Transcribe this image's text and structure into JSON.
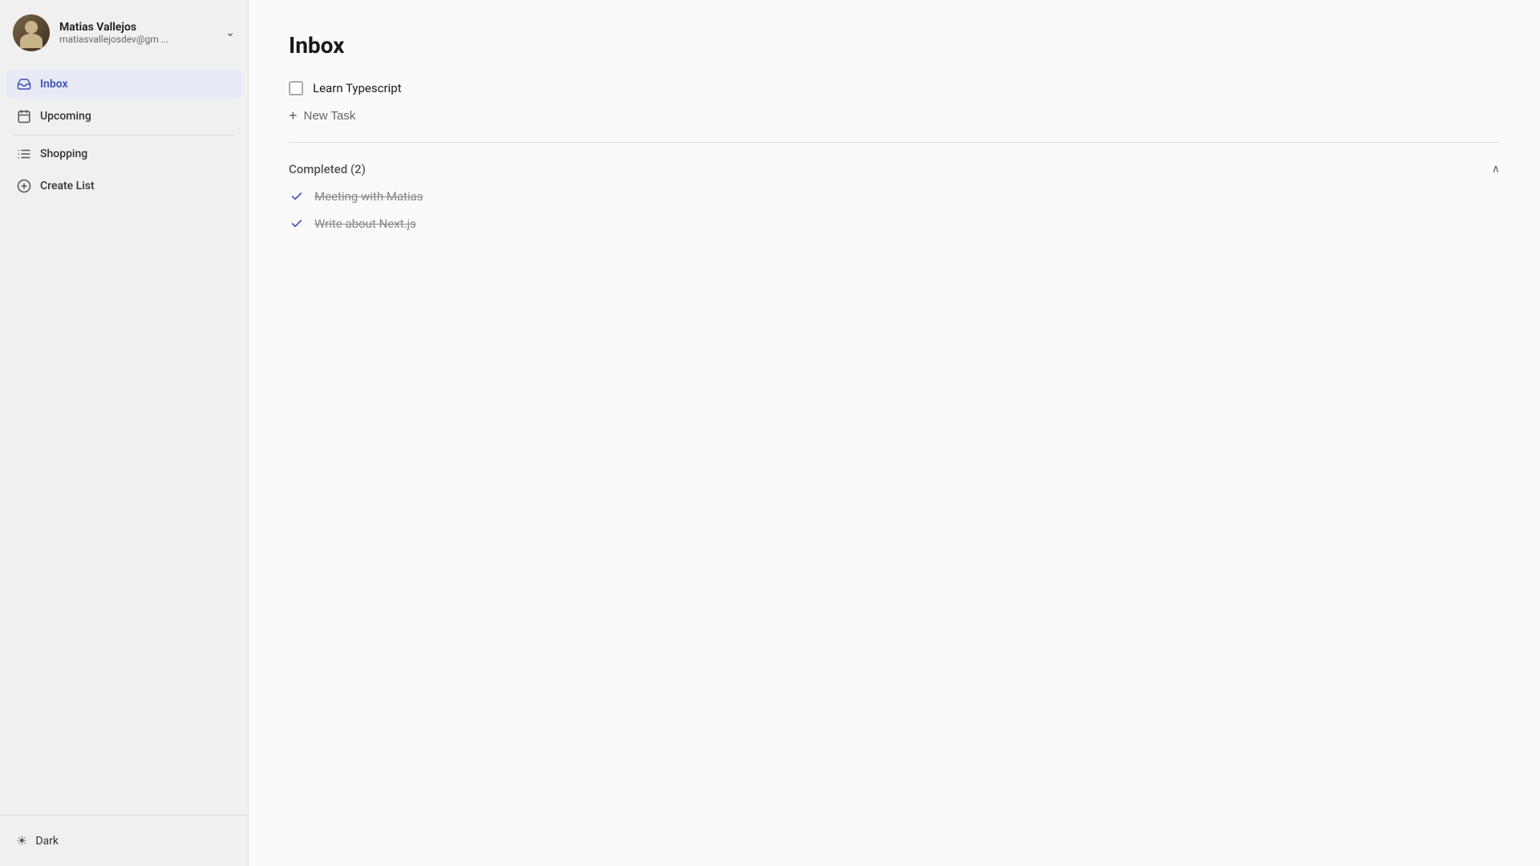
{
  "sidebar": {
    "user": {
      "name": "Matias Vallejos",
      "email": "matiasvallejosdev@gm ..."
    },
    "nav_items": [
      {
        "id": "inbox",
        "label": "Inbox",
        "icon": "inbox-icon",
        "active": true
      },
      {
        "id": "upcoming",
        "label": "Upcoming",
        "icon": "calendar-icon",
        "active": false
      },
      {
        "id": "shopping",
        "label": "Shopping",
        "icon": "list-icon",
        "active": false
      },
      {
        "id": "create-list",
        "label": "Create List",
        "icon": "plus-circle-icon",
        "active": false
      }
    ],
    "dark_mode_label": "Dark"
  },
  "main": {
    "title": "Inbox",
    "tasks": [
      {
        "id": 1,
        "label": "Learn Typescript",
        "completed": false
      }
    ],
    "new_task_label": "New Task",
    "completed_section": {
      "title": "Completed (2)",
      "collapsed": false,
      "items": [
        {
          "id": 1,
          "label": "Meeting with Matias"
        },
        {
          "id": 2,
          "label": "Write about Next.js"
        }
      ]
    }
  },
  "colors": {
    "active_nav": "#3f51b5",
    "active_nav_bg": "#e8eaf6",
    "check_color": "#3f51b5"
  }
}
